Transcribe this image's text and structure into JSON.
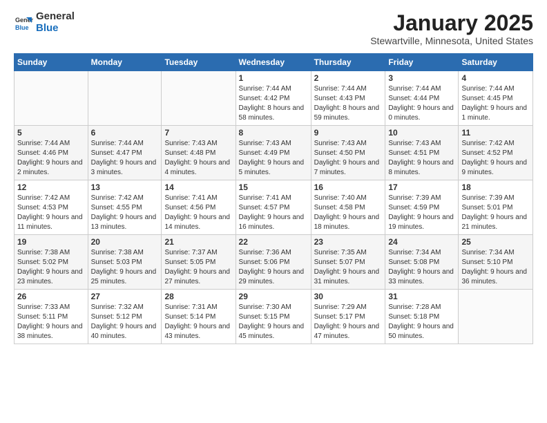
{
  "header": {
    "logo_general": "General",
    "logo_blue": "Blue",
    "month_title": "January 2025",
    "location": "Stewartville, Minnesota, United States"
  },
  "weekdays": [
    "Sunday",
    "Monday",
    "Tuesday",
    "Wednesday",
    "Thursday",
    "Friday",
    "Saturday"
  ],
  "weeks": [
    [
      {
        "day": "",
        "info": ""
      },
      {
        "day": "",
        "info": ""
      },
      {
        "day": "",
        "info": ""
      },
      {
        "day": "1",
        "info": "Sunrise: 7:44 AM\nSunset: 4:42 PM\nDaylight: 8 hours and 58 minutes."
      },
      {
        "day": "2",
        "info": "Sunrise: 7:44 AM\nSunset: 4:43 PM\nDaylight: 8 hours and 59 minutes."
      },
      {
        "day": "3",
        "info": "Sunrise: 7:44 AM\nSunset: 4:44 PM\nDaylight: 9 hours and 0 minutes."
      },
      {
        "day": "4",
        "info": "Sunrise: 7:44 AM\nSunset: 4:45 PM\nDaylight: 9 hours and 1 minute."
      }
    ],
    [
      {
        "day": "5",
        "info": "Sunrise: 7:44 AM\nSunset: 4:46 PM\nDaylight: 9 hours and 2 minutes."
      },
      {
        "day": "6",
        "info": "Sunrise: 7:44 AM\nSunset: 4:47 PM\nDaylight: 9 hours and 3 minutes."
      },
      {
        "day": "7",
        "info": "Sunrise: 7:43 AM\nSunset: 4:48 PM\nDaylight: 9 hours and 4 minutes."
      },
      {
        "day": "8",
        "info": "Sunrise: 7:43 AM\nSunset: 4:49 PM\nDaylight: 9 hours and 5 minutes."
      },
      {
        "day": "9",
        "info": "Sunrise: 7:43 AM\nSunset: 4:50 PM\nDaylight: 9 hours and 7 minutes."
      },
      {
        "day": "10",
        "info": "Sunrise: 7:43 AM\nSunset: 4:51 PM\nDaylight: 9 hours and 8 minutes."
      },
      {
        "day": "11",
        "info": "Sunrise: 7:42 AM\nSunset: 4:52 PM\nDaylight: 9 hours and 9 minutes."
      }
    ],
    [
      {
        "day": "12",
        "info": "Sunrise: 7:42 AM\nSunset: 4:53 PM\nDaylight: 9 hours and 11 minutes."
      },
      {
        "day": "13",
        "info": "Sunrise: 7:42 AM\nSunset: 4:55 PM\nDaylight: 9 hours and 13 minutes."
      },
      {
        "day": "14",
        "info": "Sunrise: 7:41 AM\nSunset: 4:56 PM\nDaylight: 9 hours and 14 minutes."
      },
      {
        "day": "15",
        "info": "Sunrise: 7:41 AM\nSunset: 4:57 PM\nDaylight: 9 hours and 16 minutes."
      },
      {
        "day": "16",
        "info": "Sunrise: 7:40 AM\nSunset: 4:58 PM\nDaylight: 9 hours and 18 minutes."
      },
      {
        "day": "17",
        "info": "Sunrise: 7:39 AM\nSunset: 4:59 PM\nDaylight: 9 hours and 19 minutes."
      },
      {
        "day": "18",
        "info": "Sunrise: 7:39 AM\nSunset: 5:01 PM\nDaylight: 9 hours and 21 minutes."
      }
    ],
    [
      {
        "day": "19",
        "info": "Sunrise: 7:38 AM\nSunset: 5:02 PM\nDaylight: 9 hours and 23 minutes."
      },
      {
        "day": "20",
        "info": "Sunrise: 7:38 AM\nSunset: 5:03 PM\nDaylight: 9 hours and 25 minutes."
      },
      {
        "day": "21",
        "info": "Sunrise: 7:37 AM\nSunset: 5:05 PM\nDaylight: 9 hours and 27 minutes."
      },
      {
        "day": "22",
        "info": "Sunrise: 7:36 AM\nSunset: 5:06 PM\nDaylight: 9 hours and 29 minutes."
      },
      {
        "day": "23",
        "info": "Sunrise: 7:35 AM\nSunset: 5:07 PM\nDaylight: 9 hours and 31 minutes."
      },
      {
        "day": "24",
        "info": "Sunrise: 7:34 AM\nSunset: 5:08 PM\nDaylight: 9 hours and 33 minutes."
      },
      {
        "day": "25",
        "info": "Sunrise: 7:34 AM\nSunset: 5:10 PM\nDaylight: 9 hours and 36 minutes."
      }
    ],
    [
      {
        "day": "26",
        "info": "Sunrise: 7:33 AM\nSunset: 5:11 PM\nDaylight: 9 hours and 38 minutes."
      },
      {
        "day": "27",
        "info": "Sunrise: 7:32 AM\nSunset: 5:12 PM\nDaylight: 9 hours and 40 minutes."
      },
      {
        "day": "28",
        "info": "Sunrise: 7:31 AM\nSunset: 5:14 PM\nDaylight: 9 hours and 43 minutes."
      },
      {
        "day": "29",
        "info": "Sunrise: 7:30 AM\nSunset: 5:15 PM\nDaylight: 9 hours and 45 minutes."
      },
      {
        "day": "30",
        "info": "Sunrise: 7:29 AM\nSunset: 5:17 PM\nDaylight: 9 hours and 47 minutes."
      },
      {
        "day": "31",
        "info": "Sunrise: 7:28 AM\nSunset: 5:18 PM\nDaylight: 9 hours and 50 minutes."
      },
      {
        "day": "",
        "info": ""
      }
    ]
  ]
}
